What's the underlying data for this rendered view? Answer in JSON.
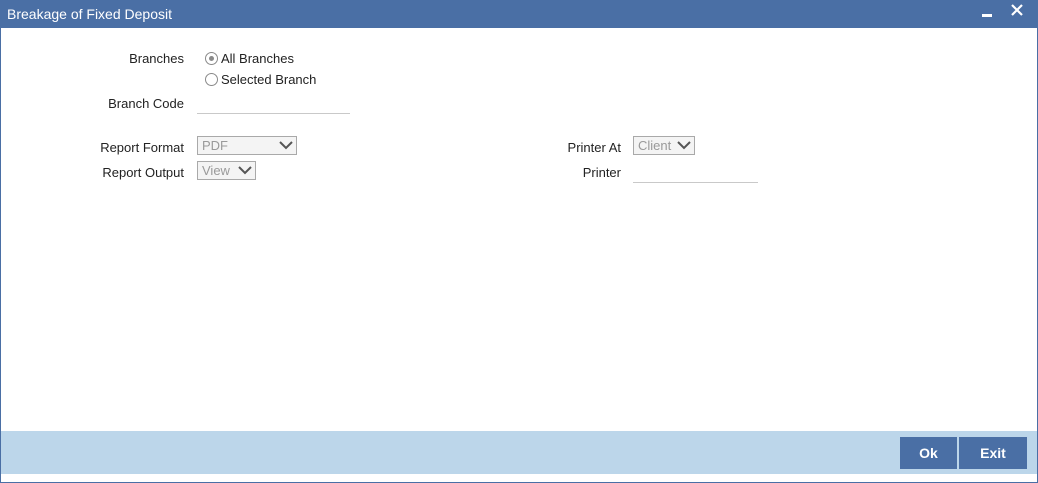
{
  "window": {
    "title": "Breakage of Fixed Deposit"
  },
  "form": {
    "branches_label": "Branches",
    "branch_options": [
      {
        "label": "All Branches",
        "selected": true
      },
      {
        "label": "Selected Branch",
        "selected": false
      }
    ],
    "branch_code_label": "Branch Code",
    "branch_code_value": "",
    "report_format_label": "Report Format",
    "report_format_value": "PDF",
    "report_output_label": "Report Output",
    "report_output_value": "View",
    "printer_at_label": "Printer At",
    "printer_at_value": "Client",
    "printer_label": "Printer",
    "printer_value": ""
  },
  "footer": {
    "ok_label": "Ok",
    "exit_label": "Exit"
  },
  "colors": {
    "titlebar": "#4a6fa5",
    "footer": "#bcd6ea",
    "button": "#4a6fa5"
  },
  "icons": [
    "minimize-icon",
    "close-icon",
    "chevron-down-icon"
  ]
}
